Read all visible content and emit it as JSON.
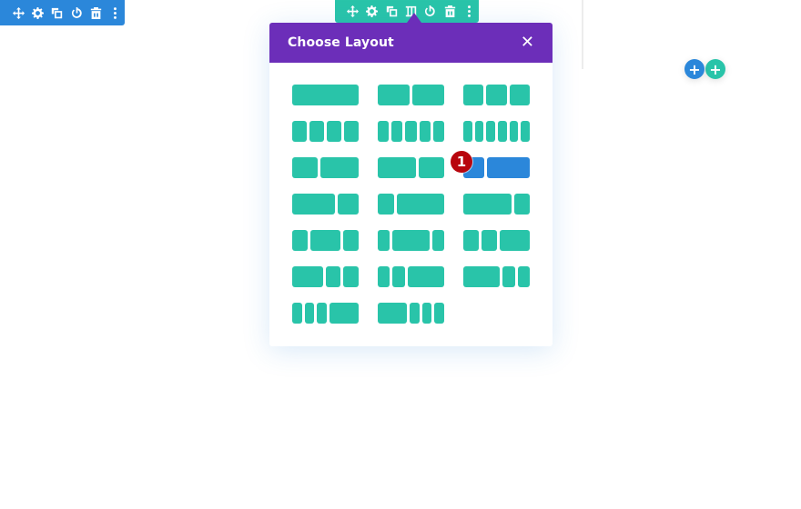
{
  "row_toolbar": {
    "color": "#2b87da",
    "icons": [
      "move-icon",
      "gear-icon",
      "duplicate-icon",
      "power-icon",
      "trash-icon",
      "more-icon"
    ]
  },
  "section_toolbar": {
    "color": "#29c4a9",
    "icons": [
      "move-icon",
      "gear-icon",
      "duplicate-icon",
      "columns-icon",
      "power-icon",
      "trash-icon",
      "more-icon"
    ]
  },
  "panel": {
    "title": "Choose Layout",
    "close_label": "✕",
    "header_color": "#6c2eb9",
    "layout_color": "#29c4a9",
    "selected_color": "#2b87da",
    "layouts": [
      {
        "name": "1/1",
        "cols": [
          1
        ]
      },
      {
        "name": "1/2,1/2",
        "cols": [
          1,
          1
        ]
      },
      {
        "name": "1/3,1/3,1/3",
        "cols": [
          1,
          1,
          1
        ]
      },
      {
        "name": "1/4 x4",
        "cols": [
          1,
          1,
          1,
          1
        ]
      },
      {
        "name": "1/5 x5",
        "cols": [
          1,
          1,
          1,
          1,
          1
        ]
      },
      {
        "name": "1/6 x6",
        "cols": [
          1,
          1,
          1,
          1,
          1,
          1
        ]
      },
      {
        "name": "2/5,3/5",
        "cols": [
          2,
          3
        ]
      },
      {
        "name": "3/5,2/5",
        "cols": [
          3,
          2
        ]
      },
      {
        "name": "1/3,2/3",
        "cols": [
          1,
          2
        ],
        "selected": true
      },
      {
        "name": "2/3,1/3",
        "cols": [
          2,
          1
        ]
      },
      {
        "name": "1/4,3/4",
        "cols": [
          1,
          3
        ]
      },
      {
        "name": "3/4,1/4",
        "cols": [
          3,
          1
        ]
      },
      {
        "name": "1/4,1/2,1/4",
        "cols": [
          1,
          2,
          1
        ]
      },
      {
        "name": "1/5,3/5,1/5",
        "cols": [
          1,
          3,
          1
        ]
      },
      {
        "name": "1/4,1/4,1/2",
        "cols": [
          1,
          1,
          2
        ]
      },
      {
        "name": "1/2,1/4,1/4",
        "cols": [
          2,
          1,
          1
        ]
      },
      {
        "name": "1/5,1/5,2/5",
        "cols": [
          1,
          1,
          3
        ]
      },
      {
        "name": "2/5,1/5,1/5",
        "cols": [
          3,
          1,
          1
        ]
      },
      {
        "name": "1/6,1/6,1/6,1/2",
        "cols": [
          1,
          1,
          1,
          3
        ]
      },
      {
        "name": "1/2,1/6,1/6,1/6",
        "cols": [
          3,
          1,
          1,
          1
        ]
      }
    ]
  },
  "annotation_badge": {
    "label": "1",
    "color": "#b8050d"
  },
  "add_buttons": [
    {
      "name": "add-row",
      "label": "+",
      "color": "#2b87da"
    },
    {
      "name": "add-section",
      "label": "+",
      "color": "#29c4a9"
    }
  ]
}
